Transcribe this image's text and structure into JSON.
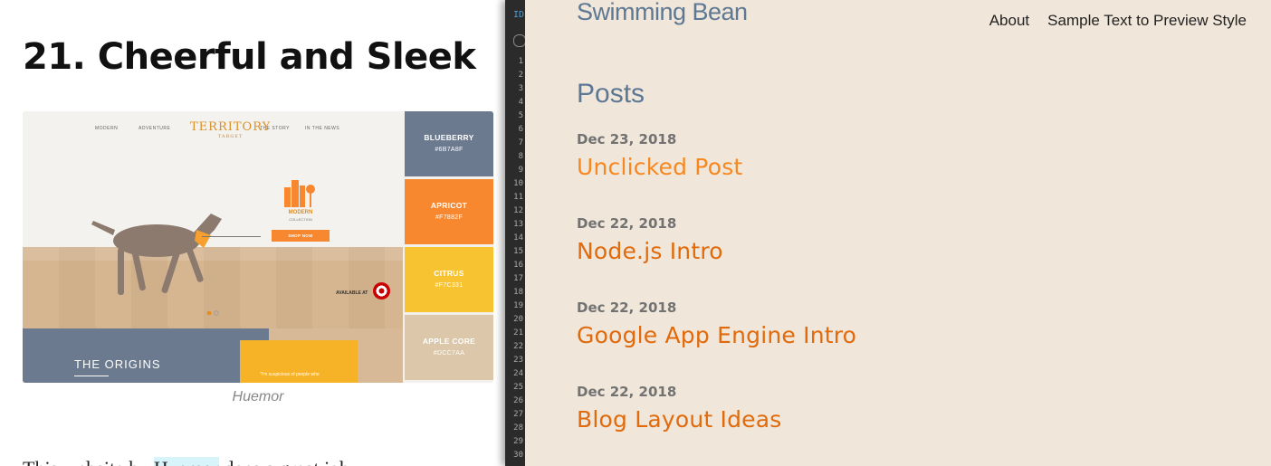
{
  "article": {
    "heading": "21. Cheerful and Sleek",
    "caption": "Huemor",
    "body_start": "This website by ",
    "body_link": "Huemor",
    "body_end": " does a great job",
    "hero": {
      "nav": [
        "MODERN",
        "ADVENTURE",
        "THE STORY",
        "IN THE NEWS"
      ],
      "logo": "TERRITORY",
      "logo_sub": "TARGET",
      "modern_label": "MODERN",
      "collection_label": "COLLECTION",
      "shop_button": "SHOP NOW",
      "available_at": "AVAILABLE AT",
      "origins": "THE ORIGINS",
      "quote": "\"I'm suspicious of people who",
      "swatches": [
        {
          "name": "BLUEBERRY",
          "hex": "#6B7A8F",
          "color": "#6b7a8f"
        },
        {
          "name": "APRICOT",
          "hex": "#F7882F",
          "color": "#f7882f"
        },
        {
          "name": "CITRUS",
          "hex": "#F7C331",
          "color": "#f7c331"
        },
        {
          "name": "APPLE CORE",
          "hex": "#DCC7AA",
          "color": "#dcc7aa"
        }
      ]
    }
  },
  "editor": {
    "tab_label": "ID",
    "line_numbers": [
      "1",
      "2",
      "3",
      "4",
      "5",
      "6",
      "7",
      "8",
      "9",
      "10",
      "11",
      "12",
      "13",
      "14",
      "15",
      "16",
      "17",
      "18",
      "19",
      "20",
      "21",
      "22",
      "23",
      "24",
      "25",
      "26",
      "27",
      "28",
      "29",
      "30"
    ]
  },
  "blog": {
    "site_title": "Swimming Bean",
    "nav": [
      "About",
      "Sample Text to Preview Style"
    ],
    "posts_heading": "Posts",
    "posts": [
      {
        "date": "Dec 23, 2018",
        "title": "Unclicked Post"
      },
      {
        "date": "Dec 22, 2018",
        "title": "Node.js Intro"
      },
      {
        "date": "Dec 22, 2018",
        "title": "Google App Engine Intro"
      },
      {
        "date": "Dec 22, 2018",
        "title": "Blog Layout Ideas"
      }
    ]
  }
}
